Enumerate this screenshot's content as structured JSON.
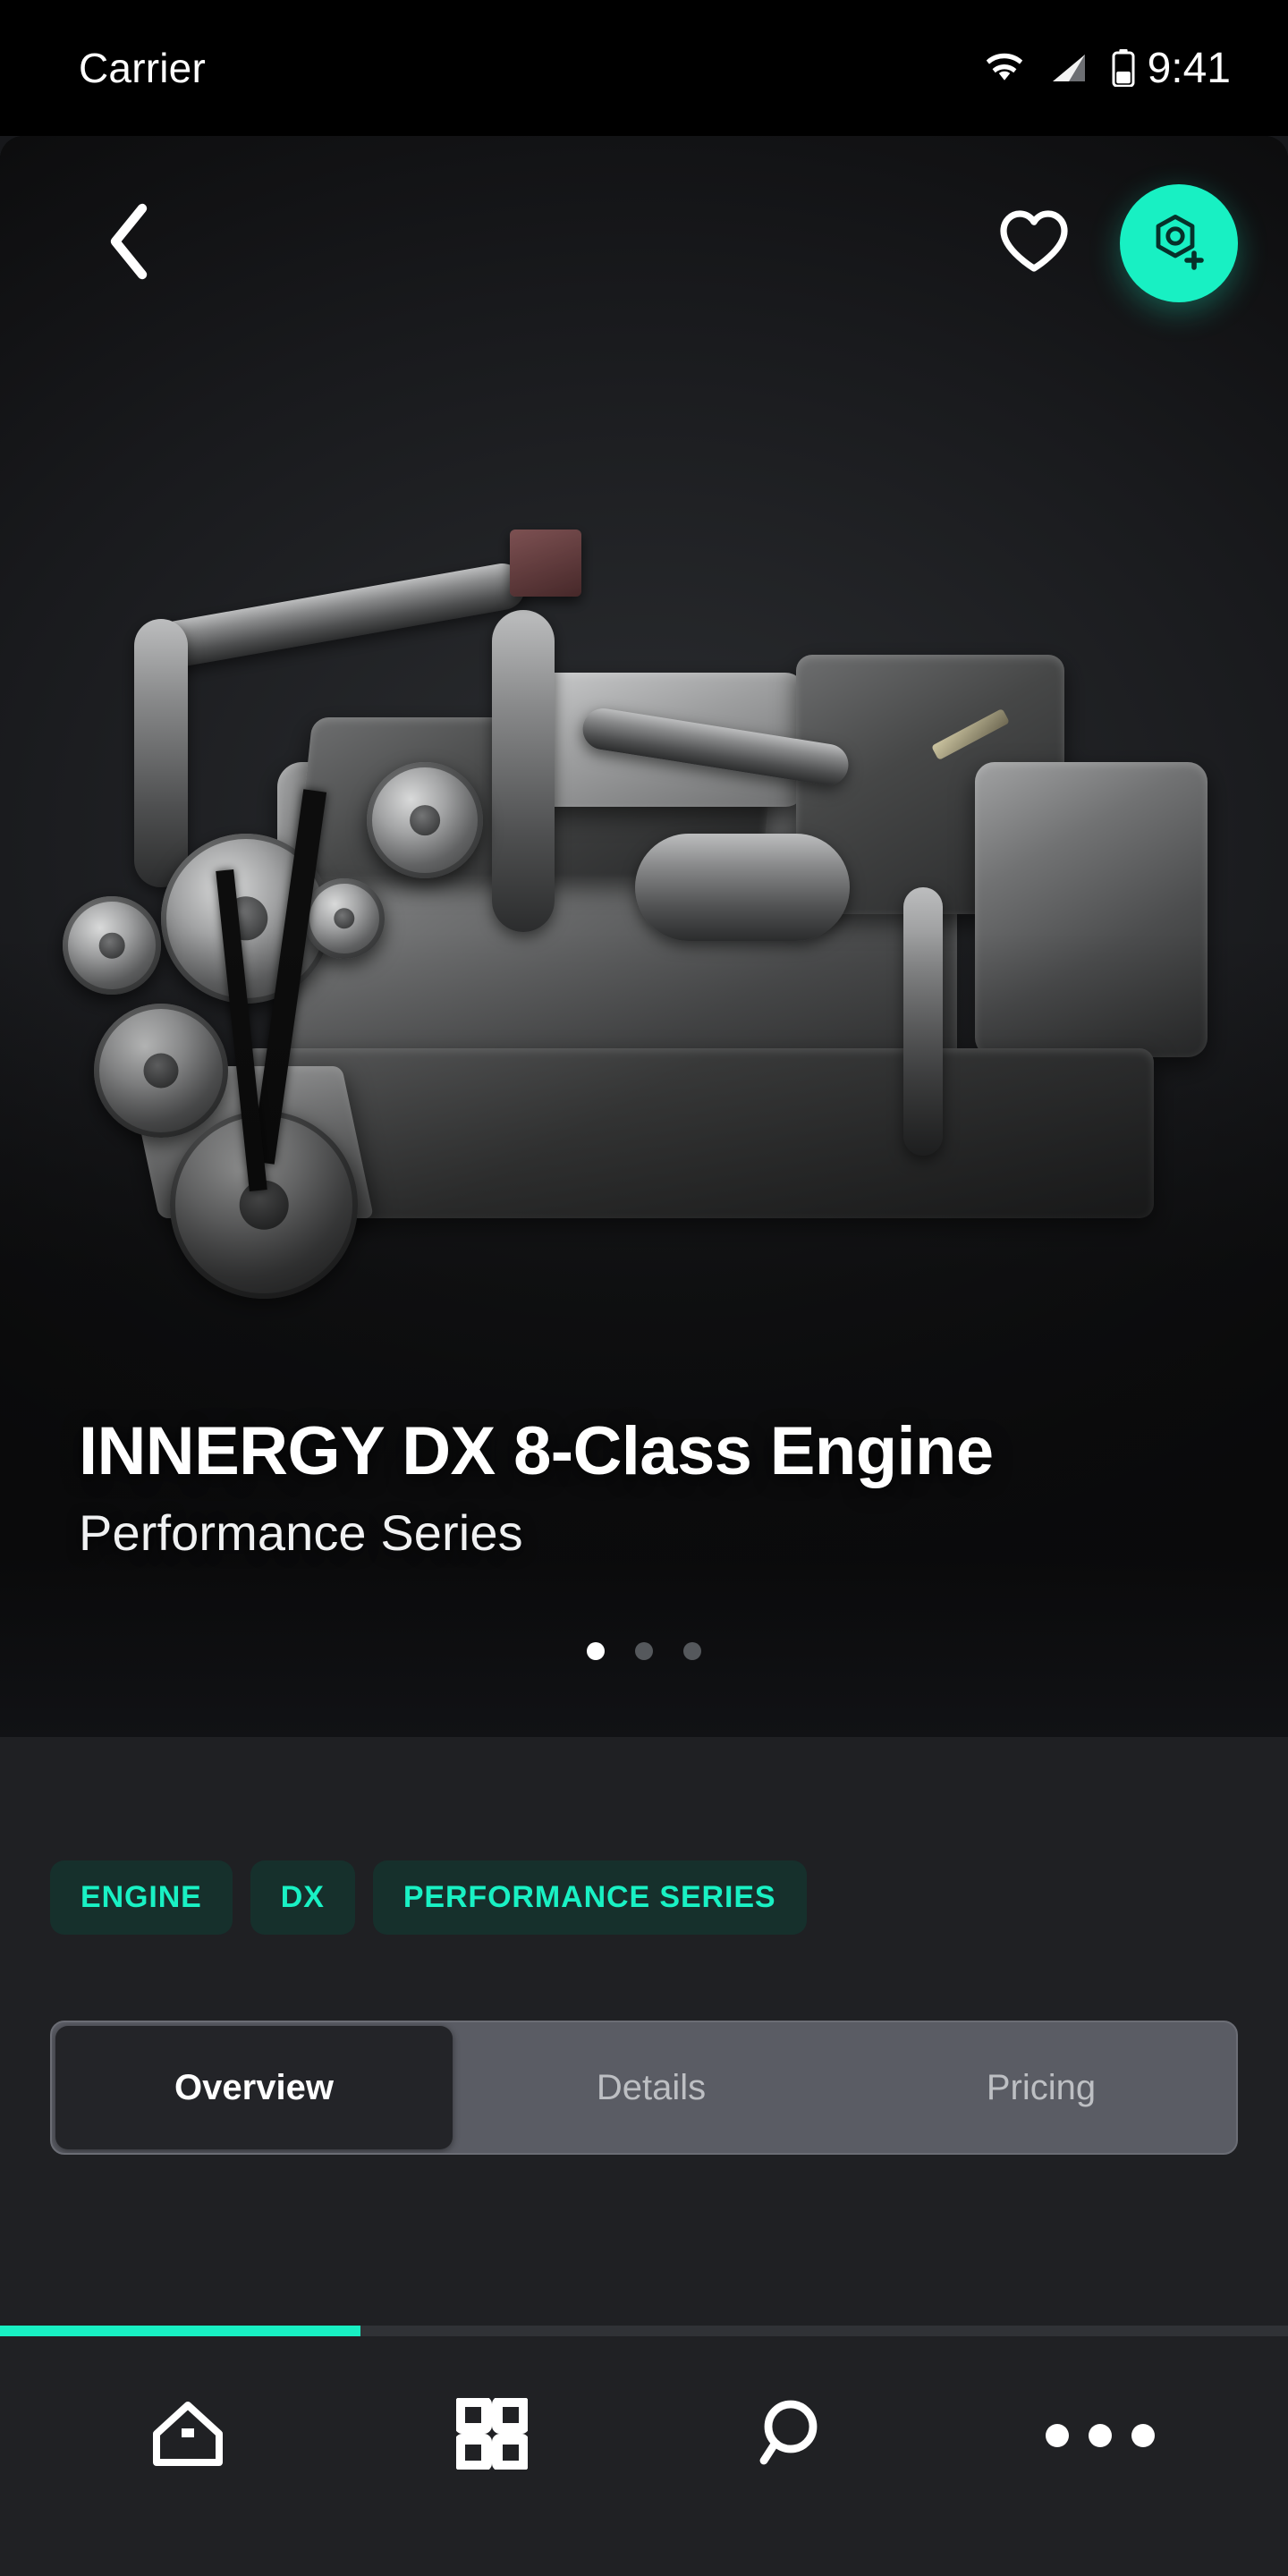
{
  "status_bar": {
    "carrier": "Carrier",
    "time": "9:41",
    "icons": [
      "wifi-icon",
      "cellular-signal-icon",
      "battery-icon"
    ]
  },
  "top_nav": {
    "back_icon": "chevron-left-icon",
    "favorite_icon": "heart-icon",
    "ar_action_icon": "ar-cube-plus-icon",
    "accent_color": "#18f0c3"
  },
  "hero": {
    "title": "INNERGY DX 8-Class Engine",
    "subtitle": "Performance Series",
    "image_alt": "product-engine-render",
    "pagination": {
      "count": 3,
      "active_index": 0
    }
  },
  "chips": [
    {
      "label": "ENGINE"
    },
    {
      "label": "DX"
    },
    {
      "label": "PERFORMANCE SERIES"
    }
  ],
  "tabs": {
    "items": [
      {
        "label": "Overview",
        "active": true
      },
      {
        "label": "Details",
        "active": false
      },
      {
        "label": "Pricing",
        "active": false
      }
    ]
  },
  "progress": {
    "percent": 28,
    "color": "#18f0c3"
  },
  "bottom_nav": {
    "items": [
      {
        "icon": "home-icon"
      },
      {
        "icon": "grid-icon"
      },
      {
        "icon": "search-icon"
      },
      {
        "icon": "more-horizontal-icon"
      }
    ]
  },
  "theme": {
    "background": "#17181b",
    "panel": "#1f2023",
    "accent": "#18f0c3",
    "chip_bg": "#16302c",
    "chip_text": "#19f1c4"
  }
}
